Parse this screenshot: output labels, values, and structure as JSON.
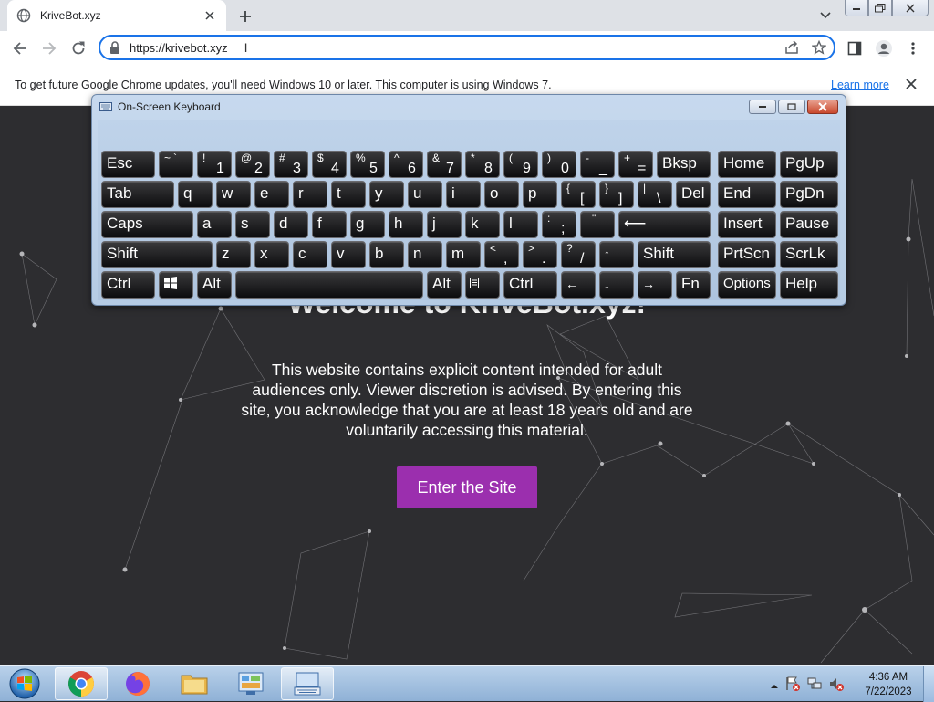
{
  "browser": {
    "tab_title": "KriveBot.xyz",
    "url": "https://krivebot.xyz",
    "infobar_message": "To get future Google Chrome updates, you'll need Windows 10 or later. This computer is using Windows 7.",
    "infobar_link": "Learn more"
  },
  "page": {
    "welcome": "Welcome to KriveBot.xyz!",
    "description": "This website contains explicit content intended for adult audiences only. Viewer discretion is advised. By entering this site, you acknowledge that you are at least 18 years old and are voluntarily accessing this material.",
    "enter_button": "Enter the Site",
    "button_color": "#9b2fae",
    "background_color": "#2d2d30"
  },
  "osk": {
    "title": "On-Screen Keyboard",
    "keys": {
      "esc": "Esc",
      "bksp": "Bksp",
      "home": "Home",
      "pgup": "PgUp",
      "tab": "Tab",
      "del": "Del",
      "end": "End",
      "pgdn": "PgDn",
      "caps": "Caps",
      "insert": "Insert",
      "pause": "Pause",
      "shift": "Shift",
      "prtscn": "PrtScn",
      "scrlk": "ScrLk",
      "ctrl": "Ctrl",
      "alt": "Alt",
      "fn": "Fn",
      "options": "Options",
      "help": "Help",
      "q": "q",
      "w": "w",
      "e": "e",
      "r": "r",
      "t": "t",
      "y": "y",
      "u": "u",
      "i": "i",
      "o": "o",
      "p": "p",
      "a": "a",
      "s": "s",
      "d": "d",
      "f": "f",
      "g": "g",
      "h": "h",
      "j": "j",
      "k": "k",
      "l": "l",
      "z": "z",
      "x": "x",
      "c": "c",
      "v": "v",
      "b": "b",
      "n": "n",
      "m": "m",
      "n1": "1",
      "n2": "2",
      "n3": "3",
      "n4": "4",
      "n5": "5",
      "n6": "6",
      "n7": "7",
      "n8": "8",
      "n9": "9",
      "n0": "0",
      "s1": "!",
      "s2": "@",
      "s3": "#",
      "s4": "$",
      "s5": "%",
      "s6": "^",
      "s7": "&",
      "s8": "*",
      "s9": "(",
      "s0": ")",
      "tilde": "~",
      "backtick": "`",
      "minus": "-",
      "underscore": "_",
      "plus": "+",
      "equals": "=",
      "lbrace": "{",
      "lbracket": "[",
      "rbrace": "}",
      "rbracket": "]",
      "pipe": "|",
      "backslash": "\\",
      "colon": ":",
      "semicolon": ";",
      "quote": "\"",
      "apos": "'",
      "lt": "<",
      "comma": ",",
      "gt": ">",
      "period": ".",
      "question": "?",
      "slash": "/",
      "enter_arrow": "⟵",
      "up": "↑",
      "left": "←",
      "down": "↓",
      "right": "→"
    }
  },
  "taskbar": {
    "time": "4:36 AM",
    "date": "7/22/2023",
    "apps": [
      "chrome",
      "firefox",
      "file-explorer",
      "control-panel",
      "on-screen-keyboard"
    ]
  }
}
